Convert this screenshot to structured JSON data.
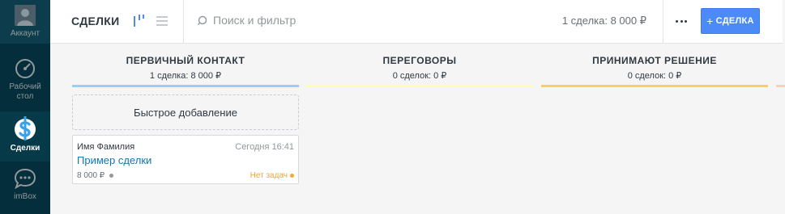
{
  "sidebar": {
    "items": [
      {
        "label": "Аккаунт",
        "icon": "avatar-icon"
      },
      {
        "label": "Рабочий стол",
        "icon": "dashboard-gauge-icon"
      },
      {
        "label": "Сделки",
        "icon": "dollar-deals-icon",
        "active": true
      },
      {
        "label": "imBox",
        "icon": "chat-bubble-icon"
      }
    ]
  },
  "header": {
    "title": "СДЕЛКИ",
    "view_icons": [
      "pipeline-view-icon",
      "list-view-icon"
    ],
    "search_placeholder": "Поиск и фильтр",
    "summary": "1 сделка: 8 000 ₽",
    "more_icon": "ellipsis-icon",
    "add_label": "СДЕЛКА"
  },
  "pipeline": {
    "columns": [
      {
        "title": "ПЕРВИЧНЫЙ КОНТАКТ",
        "count": "1 сделка: 8 000 ₽",
        "color": "#99ccff"
      },
      {
        "title": "ПЕРЕГОВОРЫ",
        "count": "0 сделок: 0 ₽",
        "color": "#fffeb2"
      },
      {
        "title": "ПРИНИМАЮТ РЕШЕНИЕ",
        "count": "0 сделок: 0 ₽",
        "color": "#ffcc66"
      }
    ],
    "quick_add": "Быстрое добавление",
    "card": {
      "contact": "Имя Фамилия",
      "time": "Сегодня 16:41",
      "title": "Пример сделки",
      "price": "8 000 ₽",
      "tasks": "Нет задач"
    }
  },
  "colors": {
    "sidebar_bg": "#042e3c",
    "accent": "#4c8bf7",
    "link": "#1375ab",
    "warning": "#f1a732"
  }
}
